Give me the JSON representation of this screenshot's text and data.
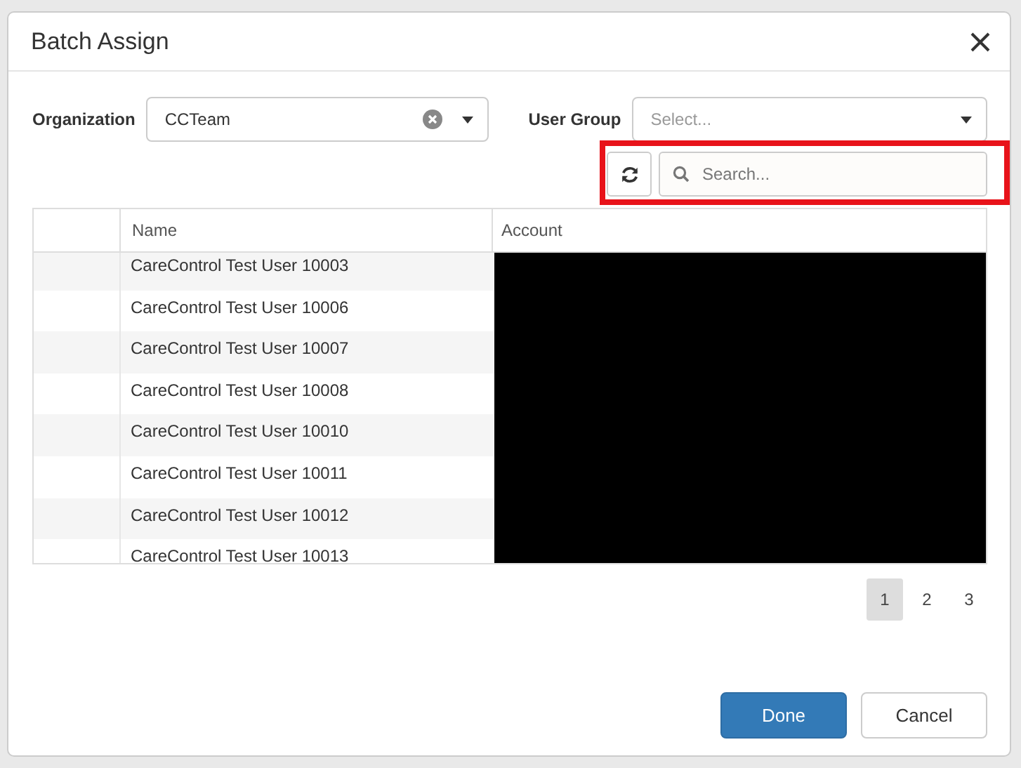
{
  "dialog": {
    "title": "Batch Assign"
  },
  "filters": {
    "organization": {
      "label": "Organization",
      "value": "CCTeam"
    },
    "user_group": {
      "label": "User Group",
      "placeholder": "Select..."
    }
  },
  "search": {
    "placeholder": "Search..."
  },
  "table": {
    "columns": [
      "Name",
      "Account"
    ],
    "rows": [
      {
        "name": "CareControl Test User 10003"
      },
      {
        "name": "CareControl Test User 10006"
      },
      {
        "name": "CareControl Test User 10007"
      },
      {
        "name": "CareControl Test User 10008"
      },
      {
        "name": "CareControl Test User 10010"
      },
      {
        "name": "CareControl Test User 10011"
      },
      {
        "name": "CareControl Test User 10012"
      },
      {
        "name": "CareControl Test User 10013"
      }
    ]
  },
  "pagination": [
    {
      "label": "1",
      "selected": true
    },
    {
      "label": "2",
      "selected": false
    },
    {
      "label": "3",
      "selected": false
    }
  ],
  "buttons": [
    {
      "label": "Done",
      "kind": "primary"
    },
    {
      "label": "Cancel",
      "kind": "default"
    }
  ]
}
